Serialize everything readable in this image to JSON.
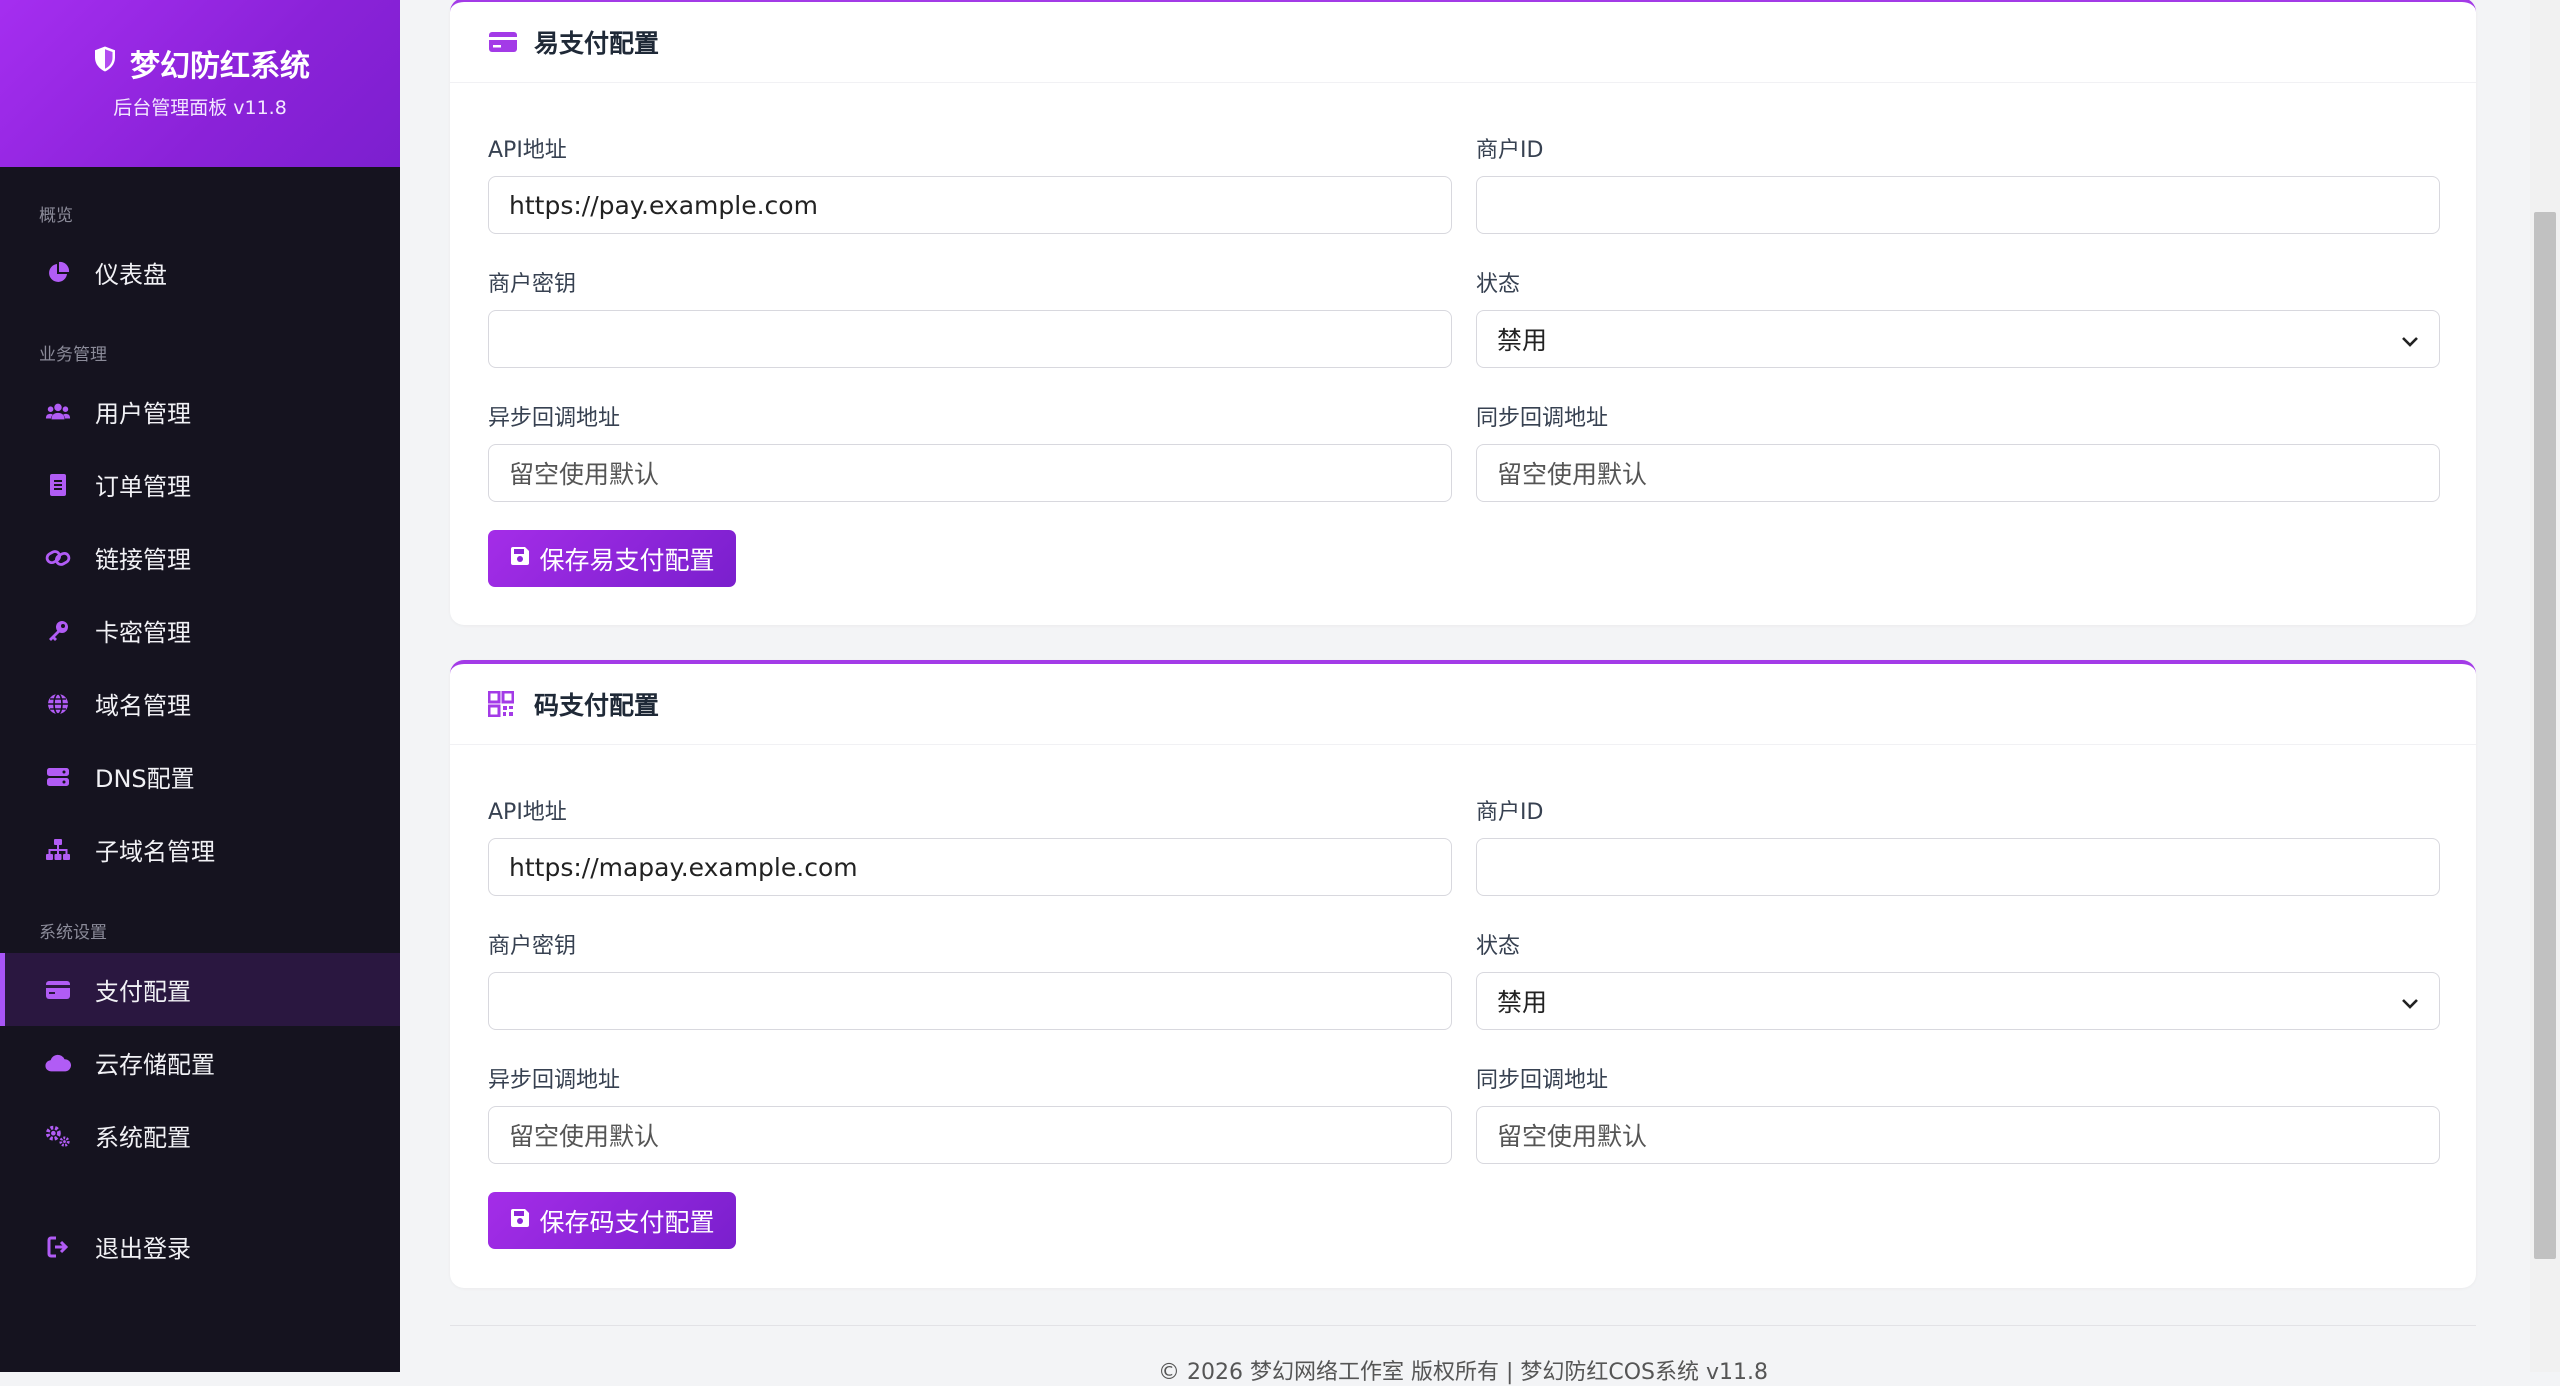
{
  "brand": {
    "title": "梦幻防红系统",
    "subtitle": "后台管理面板 v11.8"
  },
  "sidebar": {
    "sections": [
      "概览",
      "业务管理",
      "系统设置"
    ],
    "items": [
      {
        "label": "仪表盘",
        "icon": "pie-chart-icon"
      },
      {
        "label": "用户管理",
        "icon": "users-icon"
      },
      {
        "label": "订单管理",
        "icon": "receipt-icon"
      },
      {
        "label": "链接管理",
        "icon": "link-icon"
      },
      {
        "label": "卡密管理",
        "icon": "key-icon"
      },
      {
        "label": "域名管理",
        "icon": "globe-icon"
      },
      {
        "label": "DNS配置",
        "icon": "server-icon"
      },
      {
        "label": "子域名管理",
        "icon": "sitemap-icon"
      },
      {
        "label": "支付配置",
        "icon": "credit-card-icon",
        "active": true
      },
      {
        "label": "云存储配置",
        "icon": "cloud-icon"
      },
      {
        "label": "系统配置",
        "icon": "gears-icon"
      }
    ],
    "logout": "退出登录"
  },
  "epay": {
    "title": "易支付配置",
    "api_label": "API地址",
    "api_value": "https://pay.example.com",
    "merchant_id_label": "商户ID",
    "merchant_id_value": "",
    "merchant_key_label": "商户密钥",
    "merchant_key_value": "",
    "status_label": "状态",
    "status_value": "禁用",
    "notify_label": "异步回调地址",
    "notify_placeholder": "留空使用默认",
    "return_label": "同步回调地址",
    "return_placeholder": "留空使用默认",
    "save_label": "保存易支付配置"
  },
  "mapay": {
    "title": "码支付配置",
    "api_label": "API地址",
    "api_value": "https://mapay.example.com",
    "merchant_id_label": "商户ID",
    "merchant_id_value": "",
    "merchant_key_label": "商户密钥",
    "merchant_key_value": "",
    "status_label": "状态",
    "status_value": "禁用",
    "notify_label": "异步回调地址",
    "notify_placeholder": "留空使用默认",
    "return_label": "同步回调地址",
    "return_placeholder": "留空使用默认",
    "save_label": "保存码支付配置"
  },
  "footer": {
    "text": "© 2026 梦幻网络工作室 版权所有 | 梦幻防红COS系统 v11.8"
  },
  "colors": {
    "accent": "#a33be7",
    "sidebar_bg": "#15131f",
    "active_bg": "#2a1740"
  }
}
